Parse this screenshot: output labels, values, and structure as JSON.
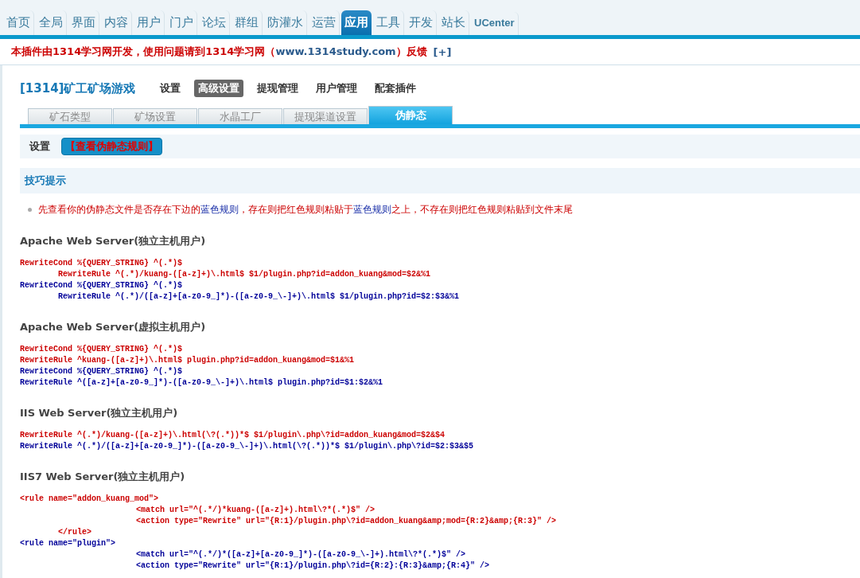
{
  "nav": [
    {
      "label": "首页",
      "selected": false
    },
    {
      "label": "全局",
      "selected": false
    },
    {
      "label": "界面",
      "selected": false
    },
    {
      "label": "内容",
      "selected": false
    },
    {
      "label": "用户",
      "selected": false
    },
    {
      "label": "门户",
      "selected": false
    },
    {
      "label": "论坛",
      "selected": false
    },
    {
      "label": "群组",
      "selected": false
    },
    {
      "label": "防灌水",
      "selected": false
    },
    {
      "label": "运营",
      "selected": false
    },
    {
      "label": "应用",
      "selected": true
    },
    {
      "label": "工具",
      "selected": false
    },
    {
      "label": "开发",
      "selected": false
    },
    {
      "label": "站长",
      "selected": false
    },
    {
      "label": "UCenter",
      "selected": false
    }
  ],
  "notice": {
    "parts": [
      {
        "kind": "red",
        "text": "本插件由1314学习网开发，使用问题请到1314学习网（"
      },
      {
        "kind": "link",
        "text": "www.1314study.com"
      },
      {
        "kind": "red",
        "text": "）反馈"
      }
    ],
    "toggle": "[+]"
  },
  "plugin": {
    "title": "[1314]矿工矿场游戏",
    "menu": [
      {
        "label": "设置",
        "selected": false
      },
      {
        "label": "高级设置",
        "selected": true
      },
      {
        "label": "提现管理",
        "selected": false
      },
      {
        "label": "用户管理",
        "selected": false
      },
      {
        "label": "配套插件",
        "selected": false
      }
    ]
  },
  "tabs": [
    {
      "label": "矿石类型",
      "selected": false
    },
    {
      "label": "矿场设置",
      "selected": false
    },
    {
      "label": "水晶工厂",
      "selected": false
    },
    {
      "label": "提现渠道设置",
      "selected": false
    },
    {
      "label": "伪静态",
      "selected": true
    }
  ],
  "toolbar": {
    "label": "设置",
    "button": "【查看伪静态规则】"
  },
  "tips": {
    "title": "技巧提示",
    "parts": [
      {
        "kind": "red",
        "text": "先查看你的伪静态文件是否存在下边的"
      },
      {
        "kind": "blue",
        "text": "蓝色规则"
      },
      {
        "kind": "red",
        "text": "，存在则把红色规则粘贴于"
      },
      {
        "kind": "blue",
        "text": "蓝色规则"
      },
      {
        "kind": "red",
        "text": "之上，不存在则把红色规则粘贴到文件末尾"
      }
    ]
  },
  "sections": [
    {
      "title": "Apache Web Server(独立主机用户)",
      "lines": [
        {
          "kind": "top",
          "color": "#cc0000",
          "text": "RewriteCond %{QUERY_STRING} ^(.*)$"
        },
        {
          "kind": "inner",
          "color": "#cc0000",
          "text": "RewriteRule ^(.*)/kuang-([a-z]+)\\.html$ $1/plugin.php?id=addon_kuang&mod=$2&%1"
        },
        {
          "kind": "top",
          "color": "#000099",
          "text": "RewriteCond %{QUERY_STRING} ^(.*)$"
        },
        {
          "kind": "inner",
          "color": "#000099",
          "text": "RewriteRule ^(.*)/([a-z]+[a-z0-9_]*)-([a-z0-9_\\-]+)\\.html$ $1/plugin.php?id=$2:$3&%1"
        }
      ]
    },
    {
      "title": "Apache Web Server(虚拟主机用户)",
      "lines": [
        {
          "kind": "top",
          "color": "#cc0000",
          "text": "RewriteCond %{QUERY_STRING} ^(.*)$"
        },
        {
          "kind": "top",
          "color": "#cc0000",
          "text": "RewriteRule ^kuang-([a-z]+)\\.html$ plugin.php?id=addon_kuang&mod=$1&%1"
        },
        {
          "kind": "top",
          "color": "#000099",
          "text": "RewriteCond %{QUERY_STRING} ^(.*)$"
        },
        {
          "kind": "top",
          "color": "#000099",
          "text": "RewriteRule ^([a-z]+[a-z0-9_]*)-([a-z0-9_\\-]+)\\.html$ plugin.php?id=$1:$2&%1"
        }
      ]
    },
    {
      "title": "IIS Web Server(独立主机用户)",
      "lines": [
        {
          "kind": "top",
          "color": "#cc0000",
          "text": "RewriteRule ^(.*)/kuang-([a-z]+)\\.html(\\?(.*))*$ $1/plugin\\.php\\?id=addon_kuang&mod=$2&$4"
        },
        {
          "kind": "top",
          "color": "#000099",
          "text": "RewriteRule ^(.*)/([a-z]+[a-z0-9_]*)-([a-z0-9_\\-]+)\\.html(\\?(.*))*$ $1/plugin\\.php\\?id=$2:$3&$5"
        }
      ]
    },
    {
      "title": "IIS7 Web Server(独立主机用户)",
      "lines": [
        {
          "kind": "top",
          "color": "#cc0000",
          "text": "<rule name=\"addon_kuang_mod\">"
        },
        {
          "kind": "deep",
          "color": "#cc0000",
          "text": "<match url=\"^(.*/)*kuang-([a-z]+).html\\?*(.*)$\" />"
        },
        {
          "kind": "deep",
          "color": "#cc0000",
          "text": "<action type=\"Rewrite\" url=\"{R:1}/plugin.php\\?id=addon_kuang&amp;mod={R:2}&amp;{R:3}\" />"
        },
        {
          "kind": "inner",
          "color": "#cc0000",
          "text": "</rule>"
        },
        {
          "kind": "top",
          "color": "#000099",
          "text": "<rule name=\"plugin\">"
        },
        {
          "kind": "deep",
          "color": "#000099",
          "text": "<match url=\"^(.*/)*([a-z]+[a-z0-9_]*)-([a-z0-9_\\-]+).html\\?*(.*)$\" />"
        },
        {
          "kind": "deep",
          "color": "#000099",
          "text": "<action type=\"Rewrite\" url=\"{R:1}/plugin.php\\?id={R:2}:{R:3}&amp;{R:4}\" />"
        }
      ]
    }
  ]
}
